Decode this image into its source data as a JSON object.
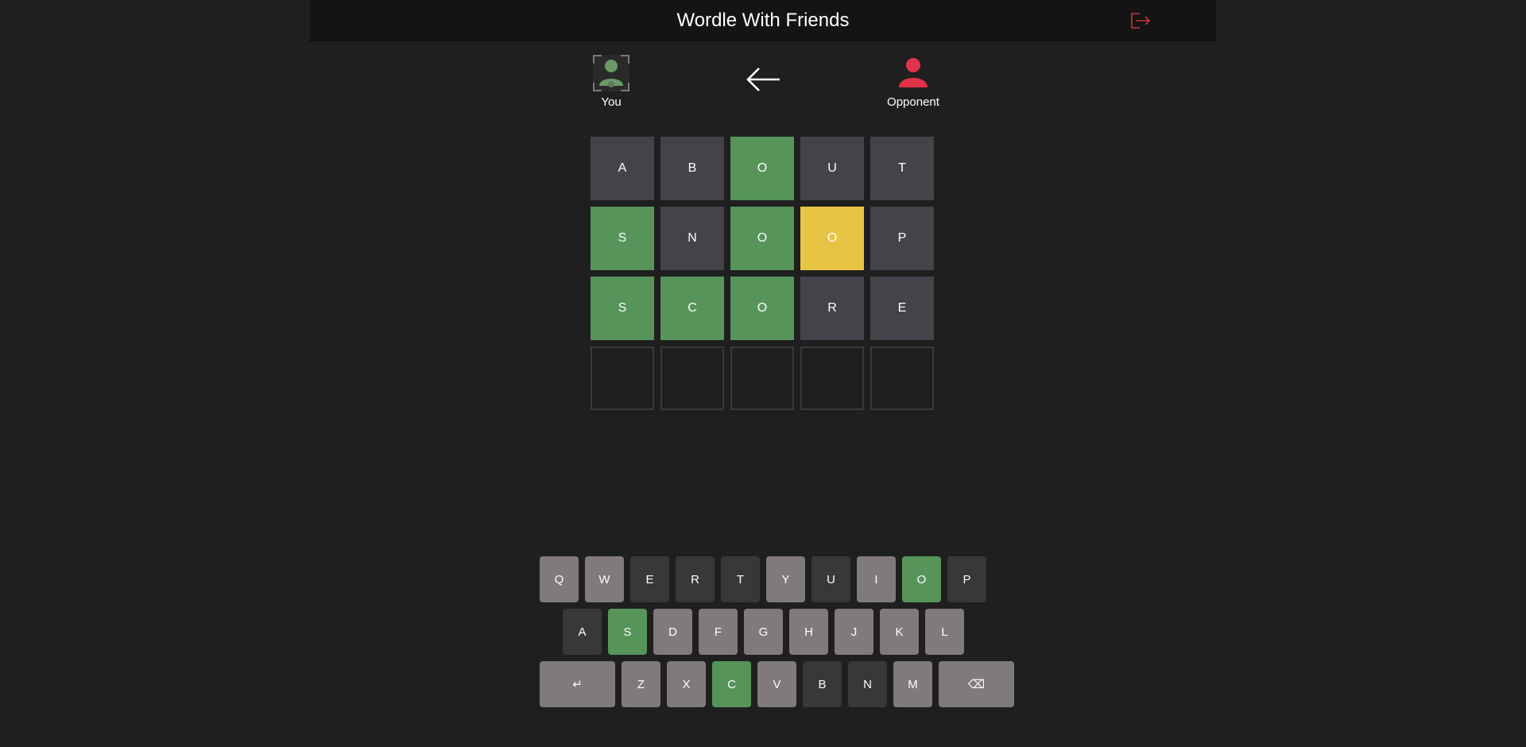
{
  "header": {
    "title": "Wordle With Friends",
    "logout_icon": "logout-icon"
  },
  "players": {
    "you": {
      "label": "You",
      "color": "#6b9a68"
    },
    "opponent": {
      "label": "Opponent",
      "color": "#e0334a"
    }
  },
  "colors": {
    "correct": "#56945a",
    "present": "#e8c444",
    "absent": "#45434a",
    "key_unused": "#807a7a",
    "key_absent": "#38383b"
  },
  "board": [
    [
      {
        "letter": "A",
        "state": "absent"
      },
      {
        "letter": "B",
        "state": "absent"
      },
      {
        "letter": "O",
        "state": "correct"
      },
      {
        "letter": "U",
        "state": "absent"
      },
      {
        "letter": "T",
        "state": "absent"
      }
    ],
    [
      {
        "letter": "S",
        "state": "correct"
      },
      {
        "letter": "N",
        "state": "absent"
      },
      {
        "letter": "O",
        "state": "correct"
      },
      {
        "letter": "O",
        "state": "present"
      },
      {
        "letter": "P",
        "state": "absent"
      }
    ],
    [
      {
        "letter": "S",
        "state": "correct"
      },
      {
        "letter": "C",
        "state": "correct"
      },
      {
        "letter": "O",
        "state": "correct"
      },
      {
        "letter": "R",
        "state": "absent"
      },
      {
        "letter": "E",
        "state": "absent"
      }
    ],
    [
      {
        "letter": "",
        "state": "empty"
      },
      {
        "letter": "",
        "state": "empty"
      },
      {
        "letter": "",
        "state": "empty"
      },
      {
        "letter": "",
        "state": "empty"
      },
      {
        "letter": "",
        "state": "empty"
      }
    ]
  ],
  "keyboard": {
    "rows": [
      [
        {
          "label": "Q",
          "state": "unused"
        },
        {
          "label": "W",
          "state": "unused"
        },
        {
          "label": "E",
          "state": "absent"
        },
        {
          "label": "R",
          "state": "absent"
        },
        {
          "label": "T",
          "state": "absent"
        },
        {
          "label": "Y",
          "state": "unused"
        },
        {
          "label": "U",
          "state": "absent"
        },
        {
          "label": "I",
          "state": "unused"
        },
        {
          "label": "O",
          "state": "correct"
        },
        {
          "label": "P",
          "state": "absent"
        }
      ],
      [
        {
          "label": "A",
          "state": "absent"
        },
        {
          "label": "S",
          "state": "correct"
        },
        {
          "label": "D",
          "state": "unused"
        },
        {
          "label": "F",
          "state": "unused"
        },
        {
          "label": "G",
          "state": "unused"
        },
        {
          "label": "H",
          "state": "unused"
        },
        {
          "label": "J",
          "state": "unused"
        },
        {
          "label": "K",
          "state": "unused"
        },
        {
          "label": "L",
          "state": "unused"
        }
      ],
      [
        {
          "label": "↵",
          "state": "unused",
          "name": "enter-key"
        },
        {
          "label": "Z",
          "state": "unused"
        },
        {
          "label": "X",
          "state": "unused"
        },
        {
          "label": "C",
          "state": "correct"
        },
        {
          "label": "V",
          "state": "unused"
        },
        {
          "label": "B",
          "state": "absent"
        },
        {
          "label": "N",
          "state": "absent"
        },
        {
          "label": "M",
          "state": "unused"
        },
        {
          "label": "⌫",
          "state": "unused",
          "name": "backspace-key"
        }
      ]
    ]
  }
}
